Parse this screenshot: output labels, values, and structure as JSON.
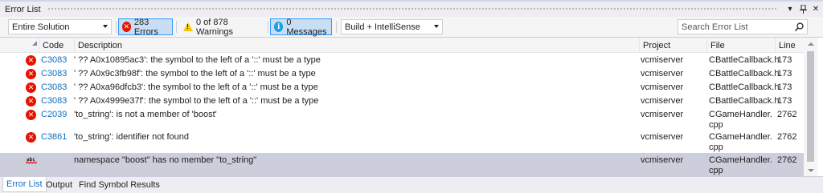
{
  "window": {
    "title": "Error List",
    "pin_icon": "pin-icon",
    "close_icon": "close-icon"
  },
  "toolbar": {
    "scope_value": "Entire Solution",
    "errors_label": "283 Errors",
    "warnings_label": "0 of 878 Warnings",
    "messages_label": "0 Messages",
    "source_value": "Build + IntelliSense",
    "search_placeholder": "Search Error List"
  },
  "columns": {
    "code": "Code",
    "description": "Description",
    "project": "Project",
    "file": "File",
    "line": "Line"
  },
  "rows": [
    {
      "icon": "error-icon",
      "code": "C3083",
      "description": "' ?? A0x10895ac3': the symbol to the left of a '::' must be a type",
      "project": "vcmiserver",
      "file": "CBattleCallback.h",
      "line": "173"
    },
    {
      "icon": "error-icon",
      "code": "C3083",
      "description": "' ?? A0x9c3fb98f': the symbol to the left of a '::' must be a type",
      "project": "vcmiserver",
      "file": "CBattleCallback.h",
      "line": "173"
    },
    {
      "icon": "error-icon",
      "code": "C3083",
      "description": "' ?? A0xa96dfcb3': the symbol to the left of a '::' must be a type",
      "project": "vcmiserver",
      "file": "CBattleCallback.h",
      "line": "173"
    },
    {
      "icon": "error-icon",
      "code": "C3083",
      "description": "' ?? A0x4999e37f': the symbol to the left of a '::' must be a type",
      "project": "vcmiserver",
      "file": "CBattleCallback.h",
      "line": "173"
    },
    {
      "icon": "error-icon",
      "code": "C2039",
      "description": "'to_string': is not a member of 'boost'",
      "project": "vcmiserver",
      "file": "CGameHandler.cpp",
      "line": "2762"
    },
    {
      "icon": "error-icon",
      "code": "C3861",
      "description": "'to_string': identifier not found",
      "project": "vcmiserver",
      "file": "CGameHandler.cpp",
      "line": "2762"
    },
    {
      "icon": "intellisense-error-icon",
      "code": "",
      "description": "namespace \"boost\" has no member \"to_string\"",
      "project": "vcmiserver",
      "file": "CGameHandler.cpp",
      "line": "2762"
    }
  ],
  "tabs": [
    "Error List",
    "Output",
    "Find Symbol Results"
  ],
  "colors": {
    "accent": "#0e70c0",
    "error": "#e51400",
    "warning": "#f8c800",
    "info": "#1ba1e2",
    "selected_row": "#cccedb"
  }
}
